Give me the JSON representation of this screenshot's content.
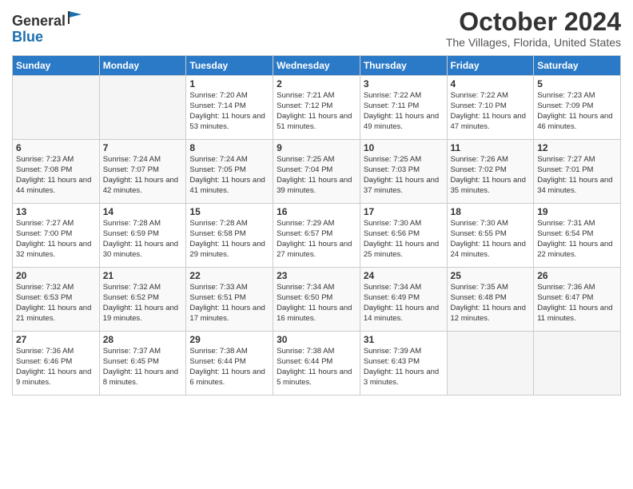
{
  "header": {
    "logo_line1": "General",
    "logo_line2": "Blue",
    "month": "October 2024",
    "location": "The Villages, Florida, United States"
  },
  "days_of_week": [
    "Sunday",
    "Monday",
    "Tuesday",
    "Wednesday",
    "Thursday",
    "Friday",
    "Saturday"
  ],
  "weeks": [
    [
      {
        "day": "",
        "sunrise": "",
        "sunset": "",
        "daylight": ""
      },
      {
        "day": "",
        "sunrise": "",
        "sunset": "",
        "daylight": ""
      },
      {
        "day": "1",
        "sunrise": "Sunrise: 7:20 AM",
        "sunset": "Sunset: 7:14 PM",
        "daylight": "Daylight: 11 hours and 53 minutes."
      },
      {
        "day": "2",
        "sunrise": "Sunrise: 7:21 AM",
        "sunset": "Sunset: 7:12 PM",
        "daylight": "Daylight: 11 hours and 51 minutes."
      },
      {
        "day": "3",
        "sunrise": "Sunrise: 7:22 AM",
        "sunset": "Sunset: 7:11 PM",
        "daylight": "Daylight: 11 hours and 49 minutes."
      },
      {
        "day": "4",
        "sunrise": "Sunrise: 7:22 AM",
        "sunset": "Sunset: 7:10 PM",
        "daylight": "Daylight: 11 hours and 47 minutes."
      },
      {
        "day": "5",
        "sunrise": "Sunrise: 7:23 AM",
        "sunset": "Sunset: 7:09 PM",
        "daylight": "Daylight: 11 hours and 46 minutes."
      }
    ],
    [
      {
        "day": "6",
        "sunrise": "Sunrise: 7:23 AM",
        "sunset": "Sunset: 7:08 PM",
        "daylight": "Daylight: 11 hours and 44 minutes."
      },
      {
        "day": "7",
        "sunrise": "Sunrise: 7:24 AM",
        "sunset": "Sunset: 7:07 PM",
        "daylight": "Daylight: 11 hours and 42 minutes."
      },
      {
        "day": "8",
        "sunrise": "Sunrise: 7:24 AM",
        "sunset": "Sunset: 7:05 PM",
        "daylight": "Daylight: 11 hours and 41 minutes."
      },
      {
        "day": "9",
        "sunrise": "Sunrise: 7:25 AM",
        "sunset": "Sunset: 7:04 PM",
        "daylight": "Daylight: 11 hours and 39 minutes."
      },
      {
        "day": "10",
        "sunrise": "Sunrise: 7:25 AM",
        "sunset": "Sunset: 7:03 PM",
        "daylight": "Daylight: 11 hours and 37 minutes."
      },
      {
        "day": "11",
        "sunrise": "Sunrise: 7:26 AM",
        "sunset": "Sunset: 7:02 PM",
        "daylight": "Daylight: 11 hours and 35 minutes."
      },
      {
        "day": "12",
        "sunrise": "Sunrise: 7:27 AM",
        "sunset": "Sunset: 7:01 PM",
        "daylight": "Daylight: 11 hours and 34 minutes."
      }
    ],
    [
      {
        "day": "13",
        "sunrise": "Sunrise: 7:27 AM",
        "sunset": "Sunset: 7:00 PM",
        "daylight": "Daylight: 11 hours and 32 minutes."
      },
      {
        "day": "14",
        "sunrise": "Sunrise: 7:28 AM",
        "sunset": "Sunset: 6:59 PM",
        "daylight": "Daylight: 11 hours and 30 minutes."
      },
      {
        "day": "15",
        "sunrise": "Sunrise: 7:28 AM",
        "sunset": "Sunset: 6:58 PM",
        "daylight": "Daylight: 11 hours and 29 minutes."
      },
      {
        "day": "16",
        "sunrise": "Sunrise: 7:29 AM",
        "sunset": "Sunset: 6:57 PM",
        "daylight": "Daylight: 11 hours and 27 minutes."
      },
      {
        "day": "17",
        "sunrise": "Sunrise: 7:30 AM",
        "sunset": "Sunset: 6:56 PM",
        "daylight": "Daylight: 11 hours and 25 minutes."
      },
      {
        "day": "18",
        "sunrise": "Sunrise: 7:30 AM",
        "sunset": "Sunset: 6:55 PM",
        "daylight": "Daylight: 11 hours and 24 minutes."
      },
      {
        "day": "19",
        "sunrise": "Sunrise: 7:31 AM",
        "sunset": "Sunset: 6:54 PM",
        "daylight": "Daylight: 11 hours and 22 minutes."
      }
    ],
    [
      {
        "day": "20",
        "sunrise": "Sunrise: 7:32 AM",
        "sunset": "Sunset: 6:53 PM",
        "daylight": "Daylight: 11 hours and 21 minutes."
      },
      {
        "day": "21",
        "sunrise": "Sunrise: 7:32 AM",
        "sunset": "Sunset: 6:52 PM",
        "daylight": "Daylight: 11 hours and 19 minutes."
      },
      {
        "day": "22",
        "sunrise": "Sunrise: 7:33 AM",
        "sunset": "Sunset: 6:51 PM",
        "daylight": "Daylight: 11 hours and 17 minutes."
      },
      {
        "day": "23",
        "sunrise": "Sunrise: 7:34 AM",
        "sunset": "Sunset: 6:50 PM",
        "daylight": "Daylight: 11 hours and 16 minutes."
      },
      {
        "day": "24",
        "sunrise": "Sunrise: 7:34 AM",
        "sunset": "Sunset: 6:49 PM",
        "daylight": "Daylight: 11 hours and 14 minutes."
      },
      {
        "day": "25",
        "sunrise": "Sunrise: 7:35 AM",
        "sunset": "Sunset: 6:48 PM",
        "daylight": "Daylight: 11 hours and 12 minutes."
      },
      {
        "day": "26",
        "sunrise": "Sunrise: 7:36 AM",
        "sunset": "Sunset: 6:47 PM",
        "daylight": "Daylight: 11 hours and 11 minutes."
      }
    ],
    [
      {
        "day": "27",
        "sunrise": "Sunrise: 7:36 AM",
        "sunset": "Sunset: 6:46 PM",
        "daylight": "Daylight: 11 hours and 9 minutes."
      },
      {
        "day": "28",
        "sunrise": "Sunrise: 7:37 AM",
        "sunset": "Sunset: 6:45 PM",
        "daylight": "Daylight: 11 hours and 8 minutes."
      },
      {
        "day": "29",
        "sunrise": "Sunrise: 7:38 AM",
        "sunset": "Sunset: 6:44 PM",
        "daylight": "Daylight: 11 hours and 6 minutes."
      },
      {
        "day": "30",
        "sunrise": "Sunrise: 7:38 AM",
        "sunset": "Sunset: 6:44 PM",
        "daylight": "Daylight: 11 hours and 5 minutes."
      },
      {
        "day": "31",
        "sunrise": "Sunrise: 7:39 AM",
        "sunset": "Sunset: 6:43 PM",
        "daylight": "Daylight: 11 hours and 3 minutes."
      },
      {
        "day": "",
        "sunrise": "",
        "sunset": "",
        "daylight": ""
      },
      {
        "day": "",
        "sunrise": "",
        "sunset": "",
        "daylight": ""
      }
    ]
  ]
}
